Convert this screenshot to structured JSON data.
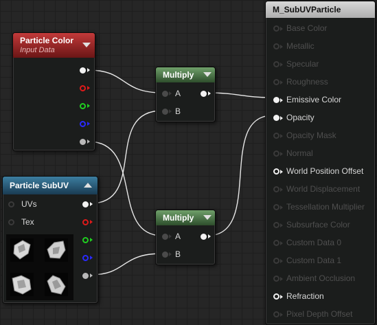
{
  "particle_color": {
    "title": "Particle Color",
    "subtitle": "Input Data"
  },
  "particle_subuv": {
    "title": "Particle SubUV",
    "inputs": [
      "UVs",
      "Tex"
    ]
  },
  "multiply_top": {
    "title": "Multiply",
    "inputs": [
      "A",
      "B"
    ]
  },
  "multiply_bottom": {
    "title": "Multiply",
    "inputs": [
      "A",
      "B"
    ]
  },
  "material": {
    "title": "M_SubUVParticle",
    "inputs": [
      {
        "label": "Base Color",
        "enabled": false
      },
      {
        "label": "Metallic",
        "enabled": false
      },
      {
        "label": "Specular",
        "enabled": false
      },
      {
        "label": "Roughness",
        "enabled": false
      },
      {
        "label": "Emissive Color",
        "enabled": true
      },
      {
        "label": "Opacity",
        "enabled": true
      },
      {
        "label": "Opacity Mask",
        "enabled": false
      },
      {
        "label": "Normal",
        "enabled": false
      },
      {
        "label": "World Position Offset",
        "enabled": true
      },
      {
        "label": "World Displacement",
        "enabled": false
      },
      {
        "label": "Tessellation Multiplier",
        "enabled": false
      },
      {
        "label": "Subsurface Color",
        "enabled": false
      },
      {
        "label": "Custom Data 0",
        "enabled": false
      },
      {
        "label": "Custom Data 1",
        "enabled": false
      },
      {
        "label": "Ambient Occlusion",
        "enabled": false
      },
      {
        "label": "Refraction",
        "enabled": true
      },
      {
        "label": "Pixel Depth Offset",
        "enabled": false
      }
    ]
  },
  "colors": {
    "wire": "#e8e8e8",
    "pin_red": "#e01a1a",
    "pin_green": "#20d020",
    "pin_blue": "#2a2aff",
    "pin_alpha": "#b8b8b8"
  }
}
